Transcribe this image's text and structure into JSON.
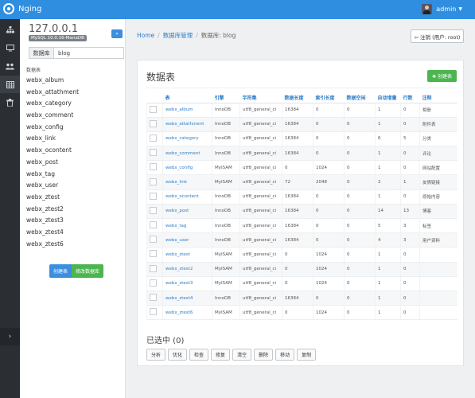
{
  "app": {
    "brand": "Nging",
    "user": "admin"
  },
  "iconbar": {
    "icons": [
      "sitemap-icon",
      "monitor-icon",
      "users-icon",
      "table-icon",
      "trash-icon"
    ],
    "expand": "›"
  },
  "sidebar": {
    "host": "127.0.0.1",
    "version": "MySQL 10.0.16-MariaDB",
    "collapse": "«",
    "db_label": "数据库",
    "db_value": "blog",
    "tables_heading": "数据表",
    "tables": [
      "webx_album",
      "webx_attathment",
      "webx_category",
      "webx_comment",
      "webx_config",
      "webx_link",
      "webx_ocontent",
      "webx_post",
      "webx_tag",
      "webx_user",
      "webx_ztest",
      "webx_ztest2",
      "webx_ztest3",
      "webx_ztest4",
      "webx_ztest6"
    ],
    "create_table": "创建表",
    "alter_db": "修改数据库"
  },
  "breadcrumb": {
    "home": "Home",
    "db_manage": "数据库管理",
    "current": "数据库: blog"
  },
  "logout": "⇦ 注销 (用户: root)",
  "main": {
    "title": "数据表",
    "create_button": "✚ 创建表",
    "columns": [
      "表",
      "引擎",
      "字符集",
      "数据长度",
      "索引长度",
      "数据空闲",
      "自动增量",
      "行数",
      "注释"
    ],
    "rows": [
      [
        "webx_album",
        "InnoDB",
        "utf8_general_ci",
        "16384",
        "0",
        "0",
        "1",
        "0",
        "相册"
      ],
      [
        "webx_attathment",
        "InnoDB",
        "utf8_general_ci",
        "16384",
        "0",
        "0",
        "1",
        "0",
        "附件表"
      ],
      [
        "webx_category",
        "InnoDB",
        "utf8_general_ci",
        "16384",
        "0",
        "0",
        "6",
        "5",
        "分类"
      ],
      [
        "webx_comment",
        "InnoDB",
        "utf8_general_ci",
        "16384",
        "0",
        "0",
        "1",
        "0",
        "评论"
      ],
      [
        "webx_config",
        "MyISAM",
        "utf8_general_ci",
        "0",
        "1024",
        "0",
        "1",
        "0",
        "网站配置"
      ],
      [
        "webx_link",
        "MyISAM",
        "utf8_general_ci",
        "72",
        "2048",
        "0",
        "2",
        "1",
        "友情链接"
      ],
      [
        "webx_ocontent",
        "InnoDB",
        "utf8_general_ci",
        "16384",
        "0",
        "0",
        "1",
        "0",
        "原始内容"
      ],
      [
        "webx_post",
        "InnoDB",
        "utf8_general_ci",
        "16384",
        "0",
        "0",
        "14",
        "13",
        "博客"
      ],
      [
        "webx_tag",
        "InnoDB",
        "utf8_general_ci",
        "16384",
        "0",
        "0",
        "5",
        "3",
        "标签"
      ],
      [
        "webx_user",
        "InnoDB",
        "utf8_general_ci",
        "16384",
        "0",
        "0",
        "4",
        "3",
        "用户资料"
      ],
      [
        "webx_ztest",
        "MyISAM",
        "utf8_general_ci",
        "0",
        "1024",
        "0",
        "1",
        "0",
        ""
      ],
      [
        "webx_ztest2",
        "MyISAM",
        "utf8_general_ci",
        "0",
        "1024",
        "0",
        "1",
        "0",
        ""
      ],
      [
        "webx_ztest3",
        "MyISAM",
        "utf8_general_ci",
        "0",
        "1024",
        "0",
        "1",
        "0",
        ""
      ],
      [
        "webx_ztest4",
        "InnoDB",
        "utf8_general_ci",
        "16384",
        "0",
        "0",
        "1",
        "0",
        ""
      ],
      [
        "webx_ztest6",
        "MyISAM",
        "utf8_general_ci",
        "0",
        "1024",
        "0",
        "1",
        "0",
        ""
      ]
    ],
    "selected_label": "已选中 (0)",
    "actions": [
      "分析",
      "优化",
      "检查",
      "修复",
      "清空",
      "删除",
      "移动",
      "复制"
    ]
  },
  "colors": {
    "topbar": "#2f8ee0",
    "iconbar": "#2b2f33",
    "link": "#2f7ec8",
    "green": "#4cb54f",
    "blue": "#3c8ee0"
  }
}
